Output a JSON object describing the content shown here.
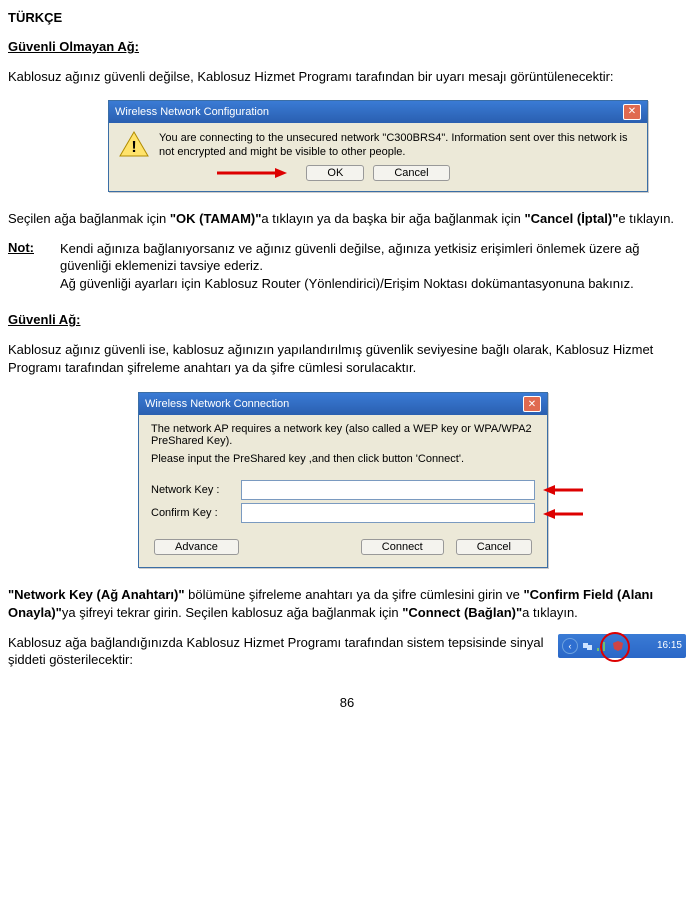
{
  "language": "TÜRKÇE",
  "sec1": {
    "header": "Güvenli Olmayan Ağ:",
    "intro": "Kablosuz ağınız güvenli değilse, Kablosuz Hizmet Programı tarafından bir uyarı mesajı görüntülenecektir:",
    "dlg": {
      "title": "Wireless Network Configuration",
      "msg": "You are connecting to the unsecured network \"C300BRS4\". Information sent over this network is not encrypted and might be visible to other people.",
      "ok": "OK",
      "cancel": "Cancel"
    },
    "postdlg_1": "Seçilen ağa bağlanmak için ",
    "postdlg_ok": "\"OK (TAMAM)\"",
    "postdlg_2": "a tıklayın ya da başka bir ağa bağlanmak için ",
    "postdlg_cancel": "\"Cancel (İptal)\"",
    "postdlg_3": "e tıklayın.",
    "note_label": "Not:",
    "note_body_1": "Kendi ağınıza bağlanıyorsanız ve ağınız güvenli değilse, ağınıza yetkisiz erişimleri önlemek üzere ağ güvenliği eklemenizi tavsiye ederiz.",
    "note_body_2": "Ağ güvenliği ayarları için Kablosuz Router (Yönlendirici)/Erişim Noktası dokümantasyonuna bakınız."
  },
  "sec2": {
    "header": "Güvenli Ağ:",
    "intro": "Kablosuz ağınız güvenli ise, kablosuz ağınızın yapılandırılmış güvenlik seviyesine bağlı olarak, Kablosuz Hizmet Programı tarafından şifreleme anahtarı ya da şifre cümlesi sorulacaktır.",
    "dlg": {
      "title": "Wireless Network Connection",
      "line1": "The network AP requires a network key (also called a WEP key or WPA/WPA2 PreShared Key).",
      "line2": "Please input the PreShared key ,and then click button 'Connect'.",
      "label_nk": "Network Key :",
      "label_ck": "Confirm Key :",
      "advance": "Advance",
      "connect": "Connect",
      "cancel": "Cancel"
    },
    "post_1a": "\"Network Key (Ağ Anahtarı)\"",
    "post_1b": " bölümüne şifreleme anahtarı ya da şifre cümlesini girin ve ",
    "post_2a": "\"Confirm Field (Alanı Onayla)\"",
    "post_2b": "ya şifreyi tekrar girin. Seçilen kablosuz ağa bağlanmak için ",
    "post_3a": "\"Connect (Bağlan)\"",
    "post_3b": "a tıklayın.",
    "tray_text": "Kablosuz ağa bağlandığınızda Kablosuz Hizmet Programı tarafından sistem tepsisinde sinyal şiddeti gösterilecektir:",
    "time": "16:15"
  },
  "page_number": "86"
}
